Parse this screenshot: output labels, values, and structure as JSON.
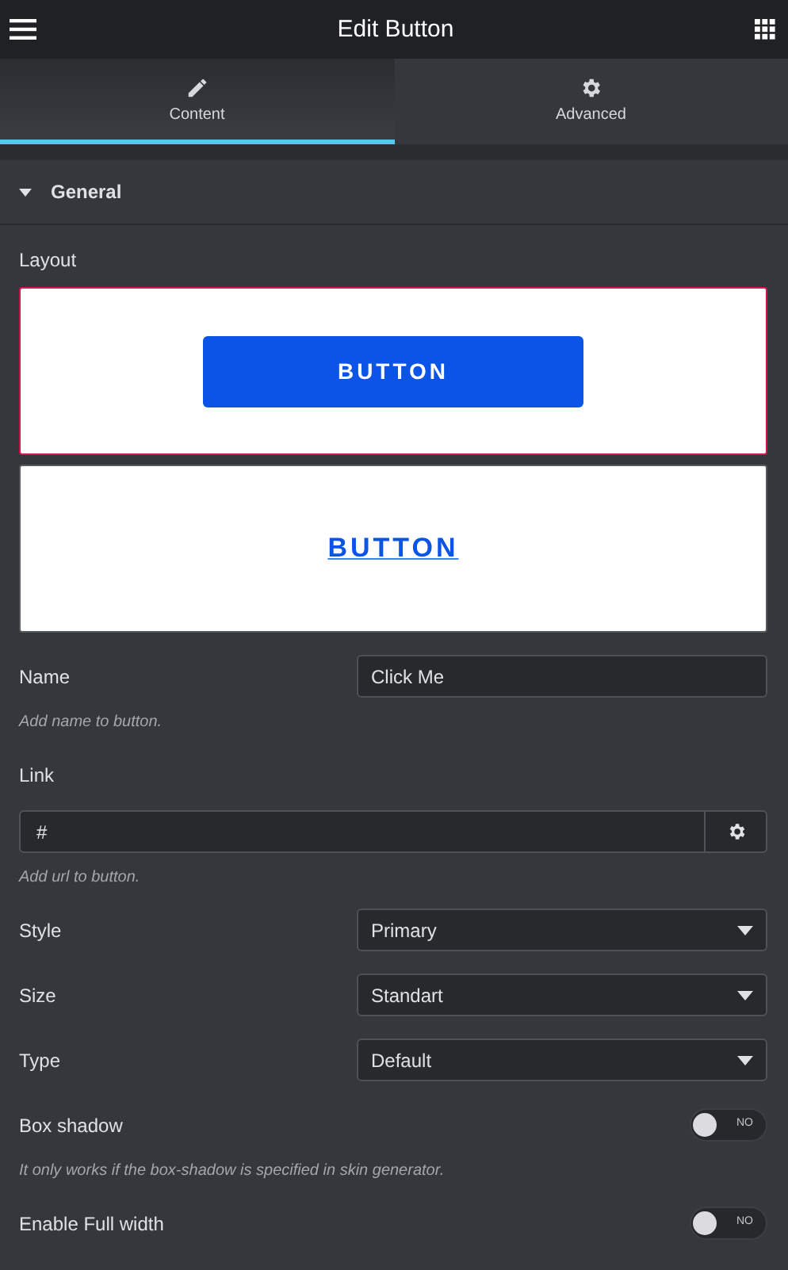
{
  "header": {
    "title": "Edit Button"
  },
  "tabs": [
    {
      "label": "Content",
      "selected": true
    },
    {
      "label": "Advanced",
      "selected": false
    }
  ],
  "section": {
    "title": "General",
    "expanded": true
  },
  "layout": {
    "label": "Layout",
    "options": [
      {
        "kind": "filled",
        "text": "BUTTON",
        "selected": true
      },
      {
        "kind": "link",
        "text": "BUTTON",
        "selected": false
      }
    ]
  },
  "fields": [
    {
      "kind": "text",
      "label": "Name",
      "value": "Click Me",
      "hint": "Add name to button."
    },
    {
      "kind": "url",
      "label": "Link",
      "value": "#",
      "hint": "Add url to button."
    },
    {
      "kind": "select",
      "label": "Style",
      "value": "Primary"
    },
    {
      "kind": "select",
      "label": "Size",
      "value": "Standart"
    },
    {
      "kind": "select",
      "label": "Type",
      "value": "Default"
    },
    {
      "kind": "toggle",
      "label": "Box shadow",
      "on": false,
      "state_text": "NO",
      "hint": "It only works if the box-shadow is specified in skin generator."
    },
    {
      "kind": "toggle",
      "label": "Enable Full width",
      "on": false,
      "state_text": "NO"
    }
  ]
}
